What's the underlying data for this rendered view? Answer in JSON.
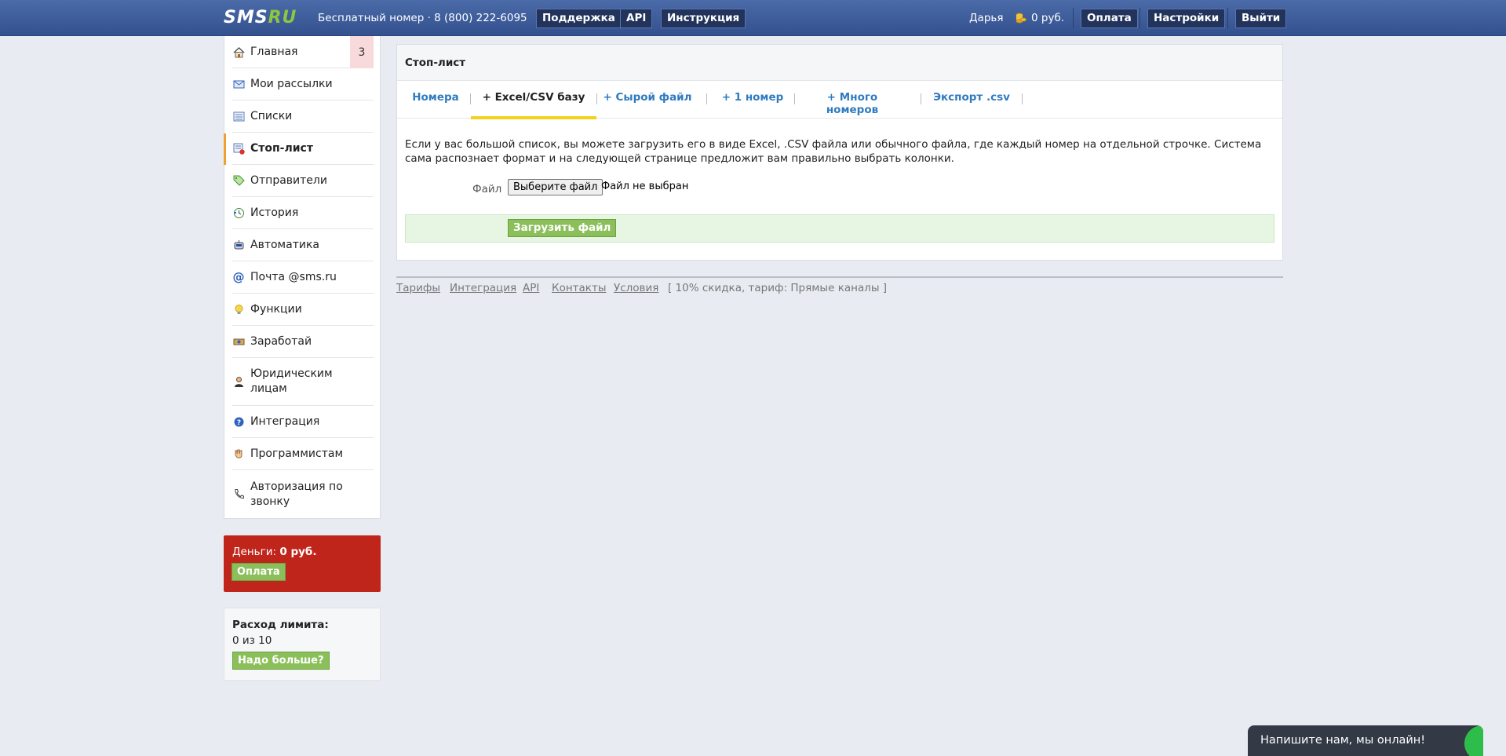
{
  "header": {
    "logo_main": "SMS",
    "logo_accent": "RU",
    "free_number": "Бесплатный номер · 8 (800) 222-6095",
    "support_label": "Поддержка",
    "api_label": "API",
    "instructions_label": "Инструкция",
    "user_name": "Дарья",
    "balance": "0 руб.",
    "pay_label": "Оплата",
    "settings_label": "Настройки",
    "logout_label": "Выйти"
  },
  "sidebar": {
    "items": [
      {
        "label": "Главная",
        "icon": "home-icon",
        "badge": "3"
      },
      {
        "label": "Мои рассылки",
        "icon": "mailings-icon"
      },
      {
        "label": "Списки",
        "icon": "lists-icon"
      },
      {
        "label": "Стоп-лист",
        "icon": "stoplist-icon",
        "active": true
      },
      {
        "label": "Отправители",
        "icon": "tag-icon"
      },
      {
        "label": "История",
        "icon": "history-icon"
      },
      {
        "label": "Автоматика",
        "icon": "robot-icon"
      },
      {
        "label": "Почта @sms.ru",
        "icon": "at-icon"
      },
      {
        "label": "Функции",
        "icon": "lightbulb-icon"
      },
      {
        "label": "Заработай",
        "icon": "money-icon"
      },
      {
        "label": "Юридическим лицам",
        "icon": "person-icon"
      },
      {
        "label": "Интеграция",
        "icon": "question-icon"
      },
      {
        "label": "Программистам",
        "icon": "hand-icon"
      },
      {
        "label": "Авторизация по звонку",
        "icon": "phone-icon"
      }
    ]
  },
  "money": {
    "label": "Деньги:",
    "value": "0 руб.",
    "pay_button": "Оплата"
  },
  "limit": {
    "title": "Расход лимита:",
    "value": "0 из 10",
    "more_button": "Надо больше?"
  },
  "panel": {
    "title": "Стоп-лист",
    "tabs": [
      {
        "label": "Номера"
      },
      {
        "label": "+ Excel/CSV базу",
        "active": true
      },
      {
        "label": "+ Сырой файл"
      },
      {
        "label": "+ 1 номер"
      },
      {
        "label": "+ Много номеров"
      },
      {
        "label": "Экспорт .csv"
      }
    ],
    "description": "Если у вас большой список, вы можете загрузить его в виде Excel, .CSV файла или обычного файла, где каждый номер на отдельной строчке. Система сама распознает формат и на следующей странице предложит вам правильно выбрать колонки.",
    "file_label": "Файл",
    "file_button": "Выберите файл",
    "file_status": "Файл не выбран",
    "upload_button": "Загрузить файл"
  },
  "footer": {
    "links": [
      "Тарифы",
      "Интеграция",
      "API",
      "Контакты",
      "Условия"
    ],
    "note": "[ 10% скидка, тариф: Прямые каналы ]"
  },
  "chat": {
    "text": "Напишите нам, мы онлайн!"
  },
  "colors": {
    "header_bg": "#3f5d9c",
    "accent_green": "#8bbf5a",
    "money_red": "#c0251c",
    "active_tab_underline": "#f3d21c",
    "link_blue": "#2f7bc0"
  }
}
